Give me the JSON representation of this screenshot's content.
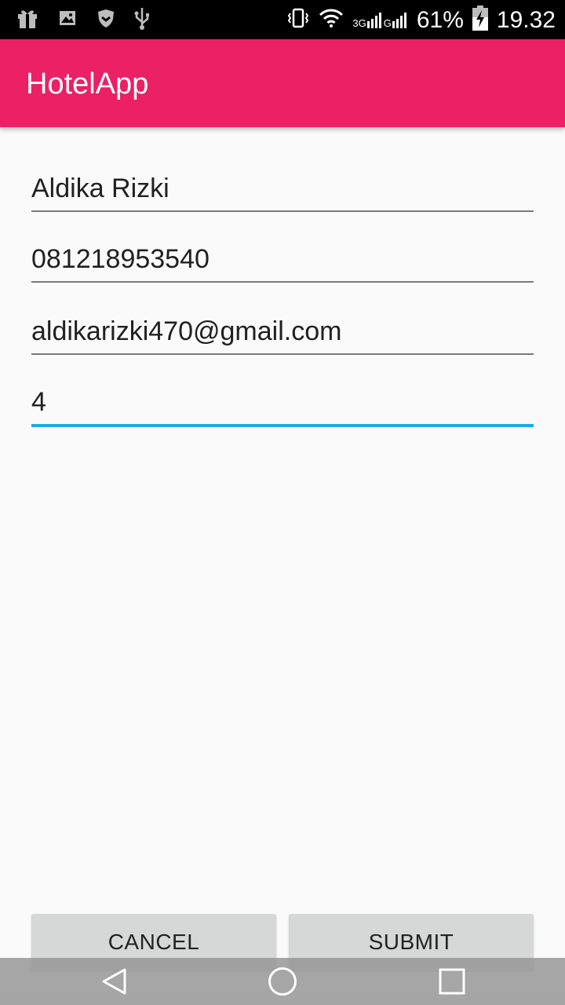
{
  "status_bar": {
    "network_3g": "3G",
    "network_g": "G",
    "battery": "61%",
    "time": "19.32",
    "icons": [
      "gift-icon",
      "image-icon",
      "shield-icon",
      "usb-icon",
      "vibrate-icon",
      "wifi-icon",
      "signal-icon",
      "battery-charging-icon"
    ]
  },
  "app_bar": {
    "title": "HotelApp",
    "color": "#ec2064"
  },
  "form": {
    "name": "Aldika Rizki",
    "phone": "081218953540",
    "email": "aldikarizki470@gmail.com",
    "rooms": "4",
    "focus_color": "#1ea9e6"
  },
  "buttons": {
    "cancel": "CANCEL",
    "submit": "SUBMIT"
  },
  "nav_bar": {
    "icons": [
      "back-icon",
      "home-icon",
      "recents-icon"
    ]
  }
}
